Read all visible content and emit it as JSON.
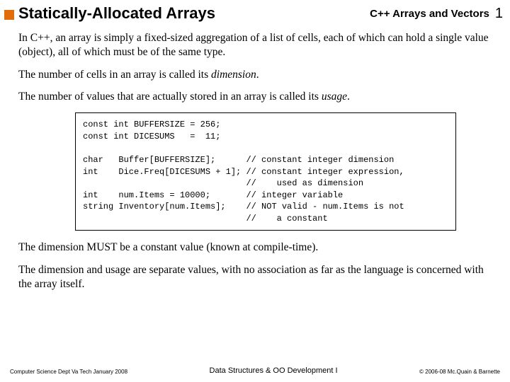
{
  "header": {
    "title": "Statically-Allocated Arrays",
    "course": "C++ Arrays and Vectors",
    "page": "1"
  },
  "body": {
    "p1": "In C++, an array is simply a fixed-sized aggregation of a list of cells, each of which can hold a single value (object), all of which must be of the same type.",
    "p2a": "The number of cells in an array is called its ",
    "p2b": "dimension",
    "p2c": ".",
    "p3a": "The number of values that are actually stored in an array is called its ",
    "p3b": "usage",
    "p3c": ".",
    "p4": "The dimension MUST be a constant value (known at compile-time).",
    "p5": "The dimension and usage are separate values, with no association as far as the language is concerned with the array itself."
  },
  "code": {
    "l1": "const int BUFFERSIZE = 256;",
    "l2": "const int DICESUMS   =  11;",
    "l3": "",
    "l4": "char   Buffer[BUFFERSIZE];      // constant integer dimension",
    "l5": "int    Dice.Freq[DICESUMS + 1]; // constant integer expression,",
    "l6": "                                //    used as dimension",
    "l7": "int    num.Items = 10000;       // integer variable",
    "l8": "string Inventory[num.Items];    // NOT valid - num.Items is not",
    "l9": "                                //    a constant"
  },
  "footer": {
    "left": "Computer Science Dept Va Tech January 2008",
    "center": "Data Structures & OO Development I",
    "right": "© 2006-08  Mc.Quain & Barnette"
  }
}
